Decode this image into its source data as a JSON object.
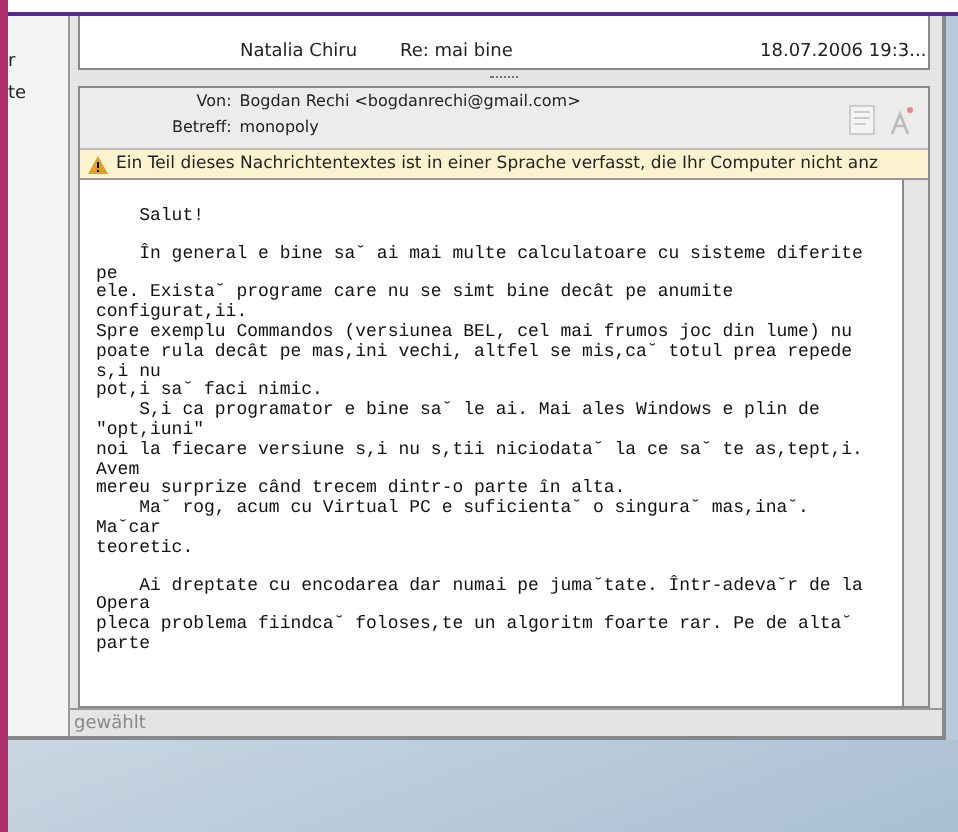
{
  "sidebar": {
    "items": [
      "r",
      "te"
    ]
  },
  "message_list": {
    "rows": [
      {
        "from": "Natalia Chiru",
        "subject": "Re: mai bine",
        "date": "18.07.2006 19:3...",
        "selected": false
      }
    ]
  },
  "header": {
    "from_label": "Von:",
    "from": "Bogdan Rechi <bogdanrechi@gmail.com>",
    "subject_label": "Betreff:",
    "subject": "monopoly"
  },
  "warning": "Ein Teil dieses Nachrichtentextes ist in einer Sprache verfasst, die Ihr Computer nicht anz",
  "body_lines": [
    "    Salut!",
    "    În general e bine sa˘ ai mai multe calculatoare cu sisteme diferite",
    "pe",
    "ele. Exista˘ programe care nu se simt bine decât pe anumite",
    "configurat,ii.",
    "Spre exemplu Commandos (versiunea BEL, cel mai frumos joc din lume) nu",
    "poate rula decât pe mas,ini vechi, altfel se mis,ca˘ totul prea repede",
    "s,i nu",
    "pot,i sa˘ faci nimic.",
    "    S,i ca programator e bine sa˘ le ai. Mai ales Windows e plin de",
    "\"opt,iuni\"",
    "noi la fiecare versiune s,i nu s,tii niciodata˘ la ce sa˘ te as,tept,i.",
    "Avem",
    "mereu surprize când trecem dintr-o parte în alta.",
    "    Ma˘ rog, acum cu Virtual PC e suficienta˘ o singura˘ mas,ina˘.",
    "Ma˘car",
    "teoretic.",
    "    Ai dreptate cu encodarea dar numai pe juma˘tate. Într-adeva˘r de la",
    "Opera",
    "pleca problema fiindca˘ foloses,te un algoritm foarte rar. Pe de alta˘",
    "parte"
  ],
  "status_bar": "gewählt"
}
